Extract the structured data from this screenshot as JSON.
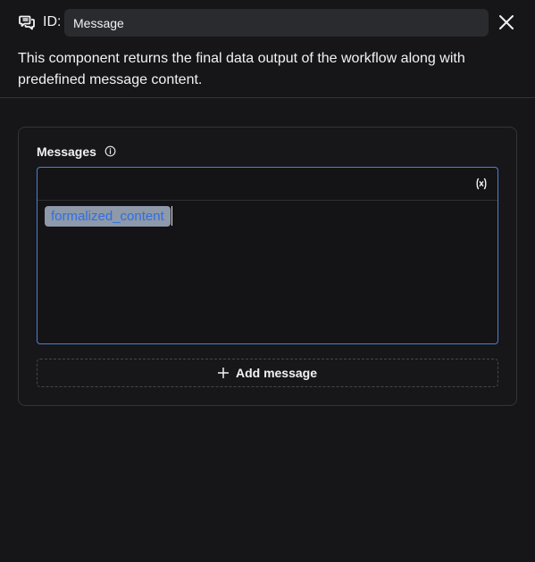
{
  "header": {
    "icon": "message-icon",
    "id_label": "ID:",
    "id_value": "Message",
    "close_icon": "close-icon"
  },
  "description": "This component returns the final data output of the workflow along with predefined message content.",
  "messages": {
    "label": "Messages",
    "info_icon": "info-icon",
    "variable_icon": "variable-icon",
    "items": [
      {
        "variable": "formalized_content"
      }
    ],
    "add_label": "Add message",
    "add_icon": "plus-icon"
  },
  "colors": {
    "background": "#161618",
    "focus_border": "#4e7fd6",
    "variable_text": "#2f6fe0",
    "variable_highlight": "#8e99aa"
  }
}
